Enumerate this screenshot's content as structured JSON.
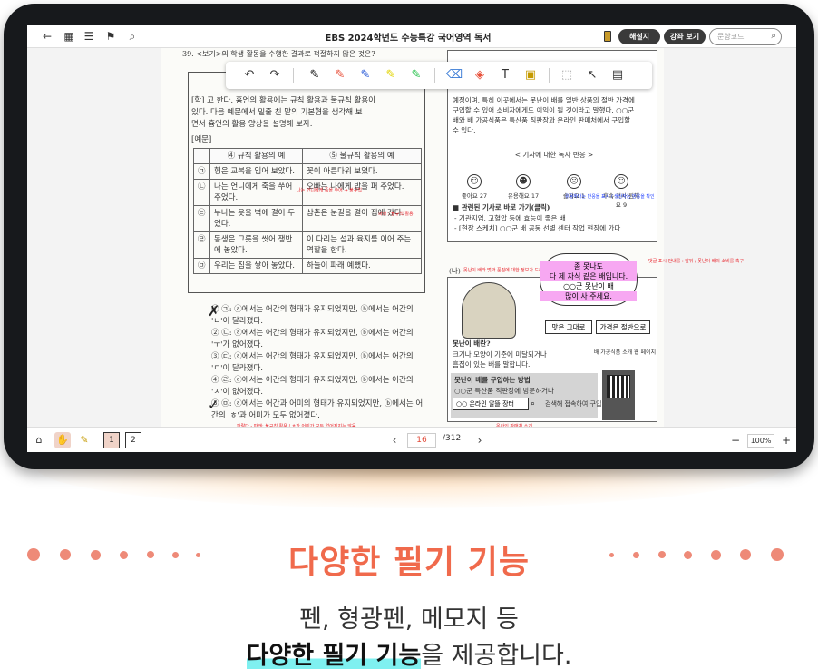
{
  "app": {
    "title": "EBS 2024학년도 수능특강 국어영역 독서",
    "commentary_button": "해설지",
    "lecture_button": "강좌 보기",
    "search_placeholder": "문항코드"
  },
  "page_left": {
    "question_head": "39. <보기>의 학생 활동을 수행한 결과로 적절하지 않은 것은?",
    "passage": [
      "[학] 고 한다. 흄언의 활용에는 규칙 활용과 불규칙 활용이",
      "있다. 다음 예문에서 밑줄 친 말의 기본형을 생각해 보",
      "면서 흄언의 활용 양상을 설명해 보자."
    ],
    "example_label": "[예문]",
    "table_headers": [
      "④ 규칙 활용의 예",
      "⑤ 불규칙 활용의 예"
    ],
    "rows": [
      {
        "mark": "㉠",
        "a": "형은 교복을 입어 보았다.",
        "b": "꽃이 아름다워 보였다."
      },
      {
        "mark": "㉡",
        "a": "나는 언니에게 죽을 쑤어 주었다.",
        "b": "오빠는 나에게 밥을 퍼 주었다."
      },
      {
        "mark": "㉢",
        "a": "누나는 옷을 벽에 걸어 두었다.",
        "b": "삼촌은 눈길을 걸어 집에 갔다."
      },
      {
        "mark": "㉣",
        "a": "동생은 그릇을 씻어 쟁반에 놓았다.",
        "b": "이 다리는 섬과 육지를 이어 주는 역할을 한다."
      },
      {
        "mark": "㉤",
        "a": "우리는 짐을 쌓아 놓았다.",
        "b": "하늘이 파래 예뻤다."
      }
    ],
    "options": [
      "① ㉠: ⓐ에서는 어간의 형태가 유지되었지만, ⓑ에서는 어간의 'ㅂ'이 달라졌다.",
      "② ㉡: ⓐ에서는 어간의 형태가 유지되었지만, ⓑ에서는 어간의 'ㅜ'가 없어졌다.",
      "③ ㉢: ⓐ에서는 어간의 형태가 유지되었지만, ⓑ에서는 어간의 'ㄷ'이 달라졌다.",
      "④ ㉣: ⓐ에서는 어간의 형태가 유지되었지만, ⓑ에서는 어간의 'ㅅ'이 없어졌다.",
      "⑤ ㉤: ⓐ에서는 어간과 어미의 형태가 유지되었지만, ⓑ에서는 어간의 'ㅎ'과 어미가 모두 없어졌다."
    ],
    "red_note": "파랗다 - 파래: 불규칙 활용 / ㅎ과 어미가 모두 없어지지는 않음."
  },
  "page_right": {
    "top_text": [
      "예정이며, 특히 이곳에서는 못난이 배를 일반 상품의 절반 가격에",
      "구입할 수 있어 소비자에게도 이익이 될 것이라고 말했다. ○○군",
      "배와 배 가공식품은 특산품 직판장과 온라인 판매처에서 구입할",
      "수 있다."
    ],
    "reaction_title": "< 기사에 대한 독자 반응 >",
    "reactions": [
      {
        "label": "좋아요 27",
        "face": "☺"
      },
      {
        "label": "유용해요 17",
        "face": "☻"
      },
      {
        "label": "슬퍼요 1",
        "face": "☹"
      },
      {
        "label": "후속 기사 원해요 9",
        "face": "☺"
      }
    ],
    "related_title": "■ 관련된 기사로 바로 가기(클릭)",
    "related": [
      "- 기관지염, 고혈압 등에 효능이 좋은 배",
      "- [현장 스케치] ○○군 배 공동 선별 센터 작업 현장에 가다"
    ],
    "section_b": "(나)",
    "bubble_lines": [
      "좀 못나도",
      "다 제 자식 같은 배입니다.",
      "○○군 못난이 배",
      "많이 사 주세요."
    ],
    "buttons": [
      "맛은 그대로",
      "가격은 절반으로"
    ],
    "ugly_title": "못난이 배란?",
    "ugly_desc": [
      "크기나 모양이 기준에 미달되거나",
      "흠집이 있는 배를 말합니다."
    ],
    "buy_title": "못난이 배를 구입하는 방법",
    "buy_desc": "○○군 특산품 직판장에 방문하거나",
    "search_store": "○○ 온라인 알뜰 장터",
    "search_suffix": "검색해 접속하여 구입",
    "qr_label": "배 가공식품 소개 웹 페이지"
  },
  "annotations": {
    "red1": "나는 언니에게 죽을 쑤어 → 불규칙",
    "red2": "파래 : 불규칙 활용",
    "blue1": "유용하다는 반응을 표시 / 생산자는 반응을 확인",
    "red3": "댓글 표시 안내를 : 앞뒤 / 못난이 배의 소비를 촉구",
    "red4": "못난이 배라 멋과 품질에 대한 정보가 드러나 있지 않음",
    "red5": "온라인 판매처 소개"
  },
  "page_numbers": {
    "left": "18",
    "right": "20"
  },
  "bottom_bar": {
    "current_page": "16",
    "total": "/312",
    "zoom": "100%",
    "page_one": "1",
    "page_two": "2"
  },
  "promo": {
    "heading": "다양한 필기 기능",
    "line1": "펜, 형광펜, 메모지 등",
    "line2_strong": "다양한 필기 기능",
    "line2_rest": "을 제공합니다."
  },
  "colors": {
    "accent": "#f06a4c",
    "highlight_pink": "#f7a8f2",
    "underline_cyan": "#7ff0f0",
    "annotation_red": "#e8222a"
  }
}
